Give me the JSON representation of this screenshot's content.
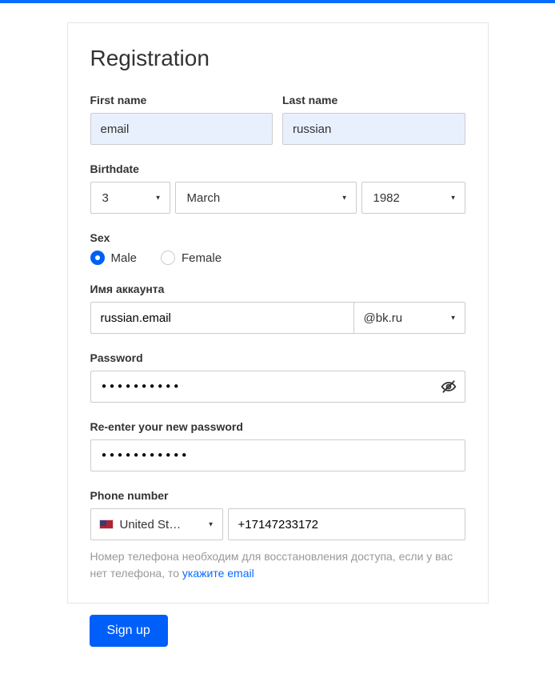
{
  "title": "Registration",
  "name": {
    "first_label": "First name",
    "first_value": "email",
    "last_label": "Last name",
    "last_value": "russian"
  },
  "birth": {
    "label": "Birthdate",
    "day": "3",
    "month": "March",
    "year": "1982"
  },
  "sex": {
    "label": "Sex",
    "male": "Male",
    "female": "Female",
    "selected": "male"
  },
  "account": {
    "label": "Имя аккаунта",
    "value": "russian.email",
    "domain": "@bk.ru"
  },
  "password": {
    "label": "Password",
    "mask": "••••••••••"
  },
  "password2": {
    "label": "Re-enter your new password",
    "mask": "•••••••••••"
  },
  "phone": {
    "label": "Phone number",
    "country": "United St…",
    "number": "+17147233172",
    "hint_prefix": "Номер телефона необходим для восстановления доступа, если у вас нет телефона, то ",
    "hint_link": "укажите email"
  },
  "submit": "Sign up"
}
